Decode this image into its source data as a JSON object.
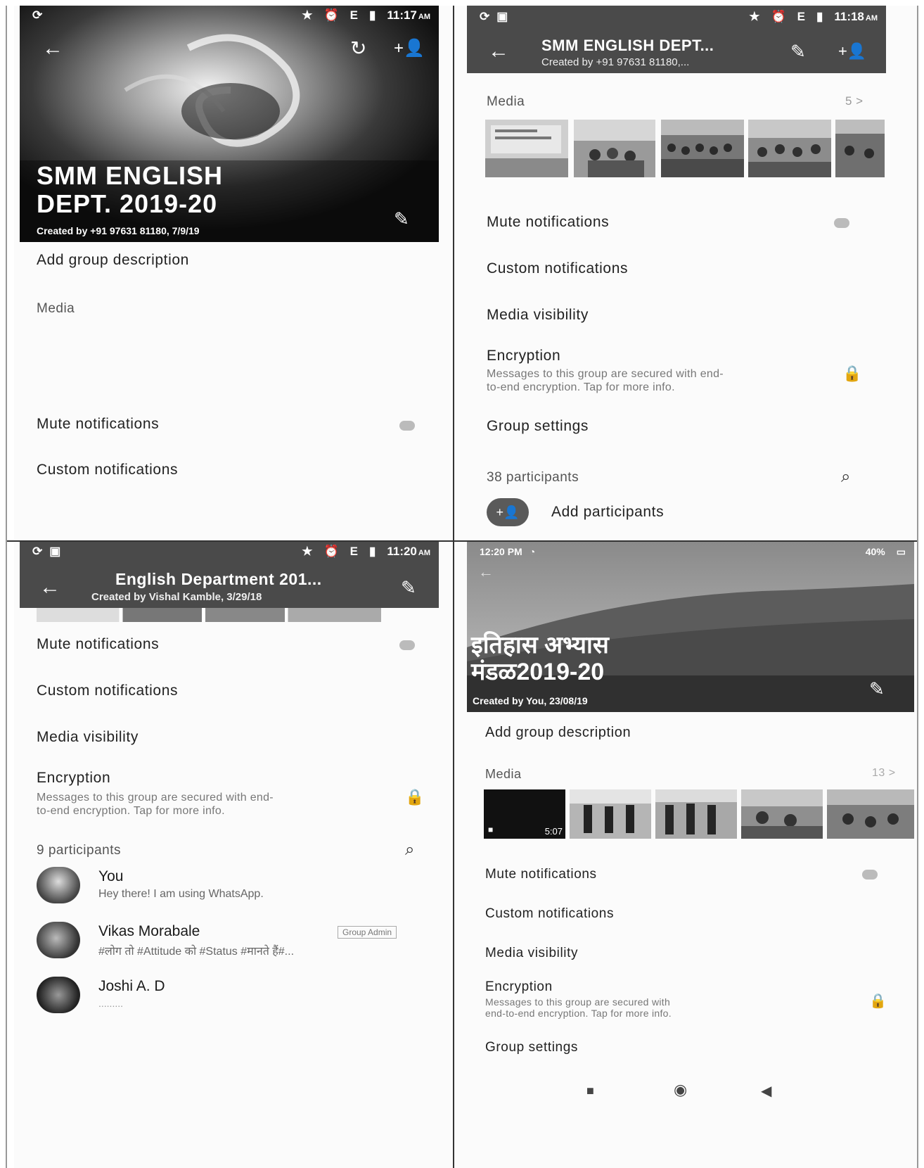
{
  "screen1": {
    "status": {
      "time": "11:17",
      "ampm": "AM",
      "net": "E"
    },
    "group_name_line1": "SMM ENGLISH",
    "group_name_line2": "DEPT. 2019-20",
    "created_by": "Created by +91 97631 81180, 7/9/19",
    "add_description": "Add group description",
    "media_label": "Media",
    "mute_notifications": "Mute notifications",
    "custom_notifications": "Custom notifications"
  },
  "screen2": {
    "status": {
      "time": "11:18",
      "ampm": "AM",
      "net": "E"
    },
    "title": "SMM ENGLISH DEPT...",
    "subtitle": "Created by +91 97631 81180,...",
    "media_label": "Media",
    "media_count": "5 >",
    "mute_notifications": "Mute notifications",
    "custom_notifications": "Custom notifications",
    "media_visibility": "Media visibility",
    "encryption_title": "Encryption",
    "encryption_line1": "Messages to this group are secured with end-",
    "encryption_line2": "to-end encryption. Tap for more info.",
    "group_settings": "Group settings",
    "participants_count": "38 participants",
    "add_participants": "Add participants"
  },
  "screen3": {
    "status": {
      "time": "11:20",
      "ampm": "AM",
      "net": "E"
    },
    "title": "English Department 201...",
    "subtitle": "Created by Vishal Kamble, 3/29/18",
    "mute_notifications": "Mute notifications",
    "custom_notifications": "Custom notifications",
    "media_visibility": "Media visibility",
    "encryption_title": "Encryption",
    "encryption_line1": "Messages to this group are secured with end-",
    "encryption_line2": "to-end encryption. Tap for more info.",
    "participants_count": "9 participants",
    "participants": [
      {
        "name": "You",
        "status": "Hey there! I am using WhatsApp.",
        "badge": ""
      },
      {
        "name": "Vikas Morabale",
        "status": "#लोग तो #Attitude को #Status #मानते हैं#...",
        "badge": "Group Admin"
      },
      {
        "name": "Joshi A. D",
        "status": ".........",
        "badge": ""
      }
    ]
  },
  "screen4": {
    "status": {
      "time": "12:20 PM",
      "battery": "40%"
    },
    "group_name_line1": "इतिहास अभ्यास",
    "group_name_line2": "मंडळ2019-20",
    "created_by": "Created by You, 23/08/19",
    "add_description": "Add group description",
    "media_label": "Media",
    "media_count": "13 >",
    "video_duration": "5:07",
    "mute_notifications": "Mute notifications",
    "custom_notifications": "Custom notifications",
    "media_visibility": "Media visibility",
    "encryption_title": "Encryption",
    "encryption_line1": "Messages to this group are secured with",
    "encryption_line2": "end-to-end encryption. Tap for more info.",
    "group_settings": "Group settings"
  }
}
